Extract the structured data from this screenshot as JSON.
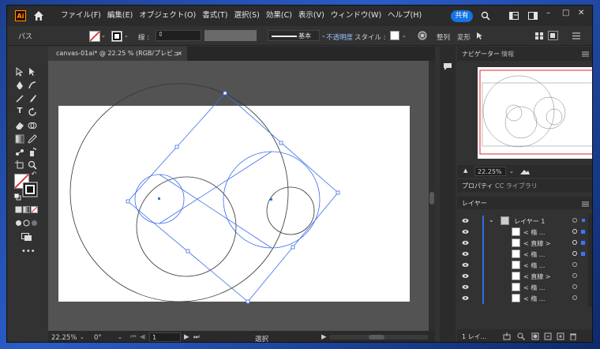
{
  "app": {
    "logo_text": "Ai",
    "share_label": "共有"
  },
  "menu": [
    "ファイル(F)",
    "編集(E)",
    "オブジェクト(O)",
    "書式(T)",
    "選択(S)",
    "効果(C)",
    "表示(V)",
    "ウィンドウ(W)",
    "ヘルプ(H)"
  ],
  "window_controls": {
    "minimize": "–",
    "maximize": "□",
    "close": "✕"
  },
  "control_bar": {
    "selection_type": "パス",
    "stroke_label": "線 :",
    "stroke_profile": "基本",
    "opacity_label": "不透明度",
    "style_label": "スタイル :",
    "align_label": "整列",
    "transform_label": "変形"
  },
  "document": {
    "tab_title": "canvas-01ai* @ 22.25 % (RGB/プレビュー)",
    "close_glyph": "×"
  },
  "status_bar": {
    "zoom": "22.25%",
    "rotation": "0°",
    "artboard": "1",
    "tool": "選択"
  },
  "navigator": {
    "tab_navigator": "ナビゲーター",
    "tab_info": "情報",
    "zoom": "22.25%"
  },
  "properties": {
    "tab_properties": "プロパティ",
    "tab_libraries": "CC ライブラリ"
  },
  "layers": {
    "tab": "レイヤー",
    "footer_count": "1 レイ...",
    "top_layer": "レイヤー 1",
    "items": [
      "< 楕 ...",
      "< 直線 >",
      "< 楕 ...",
      "< 楕 ...",
      "< 直線 >",
      "< 楕 ...",
      "< 楕 ..."
    ]
  },
  "colors": {
    "accent": "#1473e6",
    "selection": "#3a6ee8",
    "layer_bar": "#2d6cf0"
  }
}
